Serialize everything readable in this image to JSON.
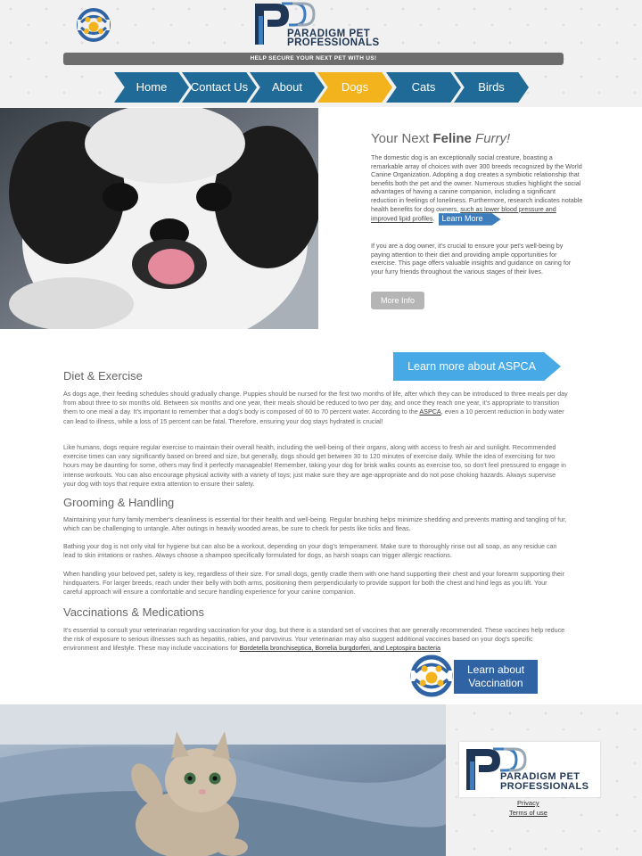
{
  "header": {
    "logo_line1": "PARADIGM PET",
    "logo_line2": "PROFESSIONALS",
    "banner": "HELP SECURE YOUR NEXT PET WITH US!"
  },
  "nav": {
    "items": [
      {
        "label": "Home"
      },
      {
        "label": "Contact Us"
      },
      {
        "label": "About"
      },
      {
        "label": "Dogs",
        "active": true
      },
      {
        "label": "Cats"
      },
      {
        "label": "Birds"
      }
    ],
    "color": "#1f6a96",
    "active_color": "#f2b31c"
  },
  "hero": {
    "title_prefix": "Your Next ",
    "title_bold": "Feline",
    "title_italic": "Furry!",
    "p1": "The domestic dog is an exceptionally social creature, boasting a remarkable array of choices with over 300 breeds recognized by the World Canine Organization. Adopting a dog creates a symbiotic relationship that benefits both the pet and the owner. Numerous studies highlight the social advantages of having a canine companion, including a significant reduction in feelings of loneliness. Furthermore, research indicates notable health benefits for dog owners,",
    "p1_link": "such as lower blood pressure and improved lipid profiles",
    "p1_end": ".",
    "learn_more": "Learn More",
    "p2": "If you are a dog owner, it's crucial to ensure your pet's well-being by paying attention to their diet and providing ample opportunities for exercise. This page offers valuable insights and guidance on caring for your furry friends throughout the various stages of their lives.",
    "more_info": "More Info"
  },
  "main": {
    "aspca_button": "Learn more about ASPCA",
    "diet_heading": "Diet & Exercise",
    "diet_p1_a": "As dogs age, their feeding schedules should gradually change. Puppies should be nursed for the first two months of life, after which they can be introduced to three meals per day from about three to six months old. Between six months and one year, their meals should be reduced to two per day, and once they reach one year, it's appropriate to transition them to one meal a day. It's important to remember that a dog's body is composed of 60 to 70 percent water. According to the",
    "diet_p1_link": "ASPCA",
    "diet_p1_b": ", even a 10 percent reduction in body water can lead to illness, while a loss of 15 percent can be fatal. Therefore, ensuring your dog stays hydrated is crucial!",
    "diet_p2": "Like humans, dogs require regular exercise to maintain their overall health, including the well-being of their organs, along with access to fresh air and sunlight. Recommended exercise times can vary significantly based on breed and size, but generally, dogs should get between 30 to 120 minutes of exercise daily. While the idea of exercising for two hours may be daunting for some, others may find it perfectly manageable! Remember, taking your dog for brisk walks counts as exercise too, so don't feel pressured to engage in intense workouts. You can also encourage physical activity with a variety of toys; just make sure they are age-appropriate and do not pose choking hazards. Always supervise your dog with toys that require extra attention to ensure their safety.",
    "grooming_heading": "Grooming & Handling",
    "grooming_p1": "Maintaining your furry family member's cleanliness is essential for their health and well-being. Regular brushing helps minimize shedding and prevents matting and tangling of fur, which can be challenging to untangle. After outings in heavily wooded areas, be sure to check for pests like ticks and fleas.",
    "grooming_p2": "Bathing your dog is not only vital for hygiene but can also be a workout, depending on your dog's temperament. Make sure to thoroughly rinse out all soap, as any residue can lead to skin irritations or rashes. Always choose a shampoo specifically formulated for dogs, as harsh soaps can trigger allergic reactions.",
    "grooming_p3": "When handling your beloved pet, safety is key, regardless of their size. For small dogs, gently cradle them with one hand supporting their chest and your forearm supporting their hindquarters. For larger breeds, reach under their belly with both arms, positioning them perpendicularly to provide support for both the chest and hind legs as you lift. Your careful approach will ensure a comfortable and secure handling experience for your canine companion.",
    "vacc_heading": "Vaccinations & Medications",
    "vacc_p1_a": "It's essential to consult your veterinarian regarding vaccination for your dog, but there is a standard set of vaccines that are generally recommended. These vaccines help reduce the risk of exposure to serious illnesses such as hepatitis, rabies, and parvovirus. Your veterinarian may also suggest additional vaccines based on your dog's specific environment and lifestyle. These may include vaccinations for",
    "vacc_p1_link": "Bordetella bronchiseptica, Borrelia burgdorferi, and Leptospira bacteria",
    "vacc_button_line1": "Learn about",
    "vacc_button_line2": "Vaccination"
  },
  "footer": {
    "logo_line1": "PARADIGM PET",
    "logo_line2": "PROFESSIONALS",
    "privacy": "Privacy",
    "terms": "Terms of use"
  }
}
